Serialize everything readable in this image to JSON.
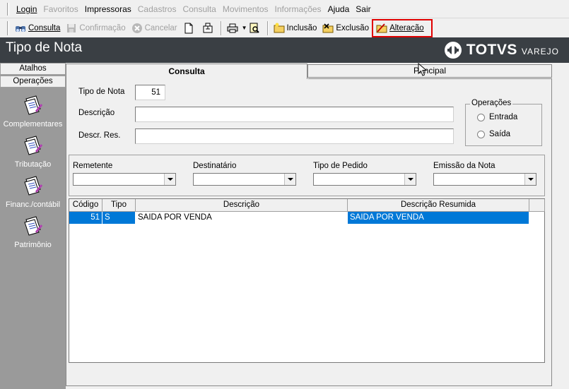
{
  "menu": {
    "items": [
      {
        "label": "Login",
        "enabled": true
      },
      {
        "label": "Favoritos",
        "enabled": false
      },
      {
        "label": "Impressoras",
        "enabled": true
      },
      {
        "label": "Cadastros",
        "enabled": false
      },
      {
        "label": "Consulta",
        "enabled": false
      },
      {
        "label": "Movimentos",
        "enabled": false
      },
      {
        "label": "Informações",
        "enabled": false
      },
      {
        "label": "Ajuda",
        "enabled": true
      },
      {
        "label": "Sair",
        "enabled": true
      }
    ]
  },
  "toolbar": {
    "consulta": "Consulta",
    "confirmacao": "Confirmação",
    "cancelar": "Cancelar",
    "inclusao": "Inclusão",
    "exclusao": "Exclusão",
    "alteracao": "Alteração"
  },
  "title": "Tipo de Nota",
  "brand": {
    "name": "TOTVS",
    "sub": "VAREJO"
  },
  "sidebar": {
    "tabs": [
      "Atalhos",
      "Operações"
    ],
    "items": [
      "Complementares",
      "Tributação",
      "Financ./contábil",
      "Patrimônio"
    ]
  },
  "tabs": {
    "consulta": "Consulta",
    "principal": "Principal"
  },
  "form": {
    "tipo_label": "Tipo de Nota",
    "tipo_value": "51",
    "descricao_label": "Descrição",
    "descricao_value": "",
    "descr_res_label": "Descr. Res.",
    "descr_res_value": ""
  },
  "operacoes": {
    "legend": "Operações",
    "entrada": "Entrada",
    "saida": "Saída"
  },
  "filters": {
    "remetente": "Remetente",
    "destinatario": "Destinatário",
    "tipo_pedido": "Tipo de Pedido",
    "emissao": "Emissão da Nota"
  },
  "grid": {
    "columns": [
      "Código",
      "Tipo",
      "Descrição",
      "Descrição Resumida"
    ],
    "rows": [
      {
        "codigo": "51",
        "tipo": "S",
        "descricao": "SAIDA POR VENDA",
        "resumida": "SAIDA POR VENDA"
      }
    ]
  },
  "colors": {
    "titlebar": "#3a3f44",
    "selection": "#0078d7",
    "highlight": "#e00000",
    "sidebar": "#9a9a9a"
  }
}
